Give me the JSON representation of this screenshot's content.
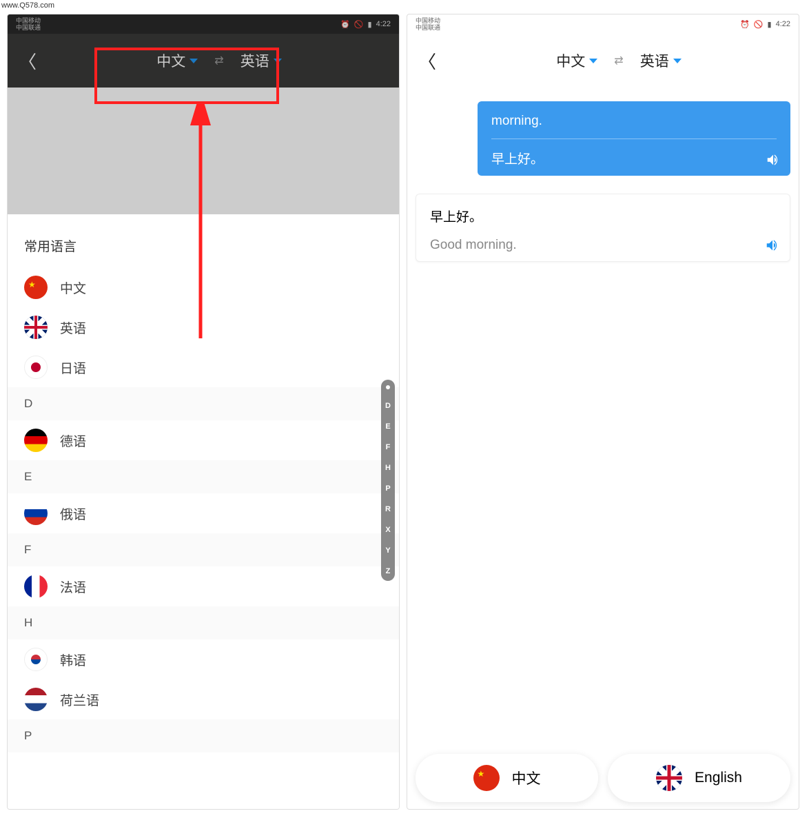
{
  "watermark": "www.Q578.com",
  "status": {
    "carrier1": "中国移动",
    "carrier2": "中国联通",
    "time": "4:22"
  },
  "header": {
    "source_lang": "中文",
    "swap": "⇄",
    "target_lang": "英语"
  },
  "left": {
    "section_common": "常用语言",
    "langs_common": [
      {
        "flag": "cn",
        "name": "中文"
      },
      {
        "flag": "uk",
        "name": "英语"
      },
      {
        "flag": "jp",
        "name": "日语"
      }
    ],
    "groups": [
      {
        "letter": "D",
        "items": [
          {
            "flag": "de",
            "name": "德语"
          }
        ]
      },
      {
        "letter": "E",
        "items": [
          {
            "flag": "ru",
            "name": "俄语"
          }
        ]
      },
      {
        "letter": "F",
        "items": [
          {
            "flag": "fr",
            "name": "法语"
          }
        ]
      },
      {
        "letter": "H",
        "items": [
          {
            "flag": "kr",
            "name": "韩语"
          },
          {
            "flag": "nl",
            "name": "荷兰语"
          }
        ]
      },
      {
        "letter": "P",
        "items": []
      }
    ],
    "index": [
      "D",
      "E",
      "F",
      "H",
      "P",
      "R",
      "X",
      "Y",
      "Z"
    ]
  },
  "right": {
    "card1": {
      "src": "morning.",
      "dst": "早上好。"
    },
    "card2": {
      "src": "早上好。",
      "dst": "Good morning."
    },
    "bottom_left": "中文",
    "bottom_right": "English"
  }
}
